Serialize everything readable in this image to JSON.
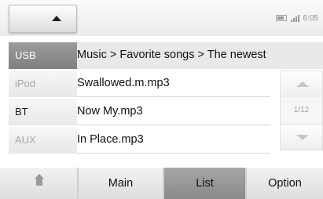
{
  "status": {
    "time": "6:05",
    "icons": [
      "battery-icon",
      "signal-icon"
    ]
  },
  "sources": [
    {
      "label": "USB"
    },
    {
      "label": "iPod"
    },
    {
      "label": "BT"
    },
    {
      "label": "AUX"
    }
  ],
  "list": {
    "header": "Music > Favorite songs > The newest",
    "items": [
      {
        "label": "Swallowed.m.mp3"
      },
      {
        "label": "Now My.mp3"
      },
      {
        "label": "In Place.mp3"
      }
    ]
  },
  "scroll": {
    "page": "1/12"
  },
  "bottom_bar": {
    "tabs": [
      {
        "label": "Main"
      },
      {
        "label": "List"
      },
      {
        "label": "Option"
      }
    ]
  },
  "colors": {
    "active": "#8a8a8a",
    "inactive_text": "#a8a8a8"
  }
}
